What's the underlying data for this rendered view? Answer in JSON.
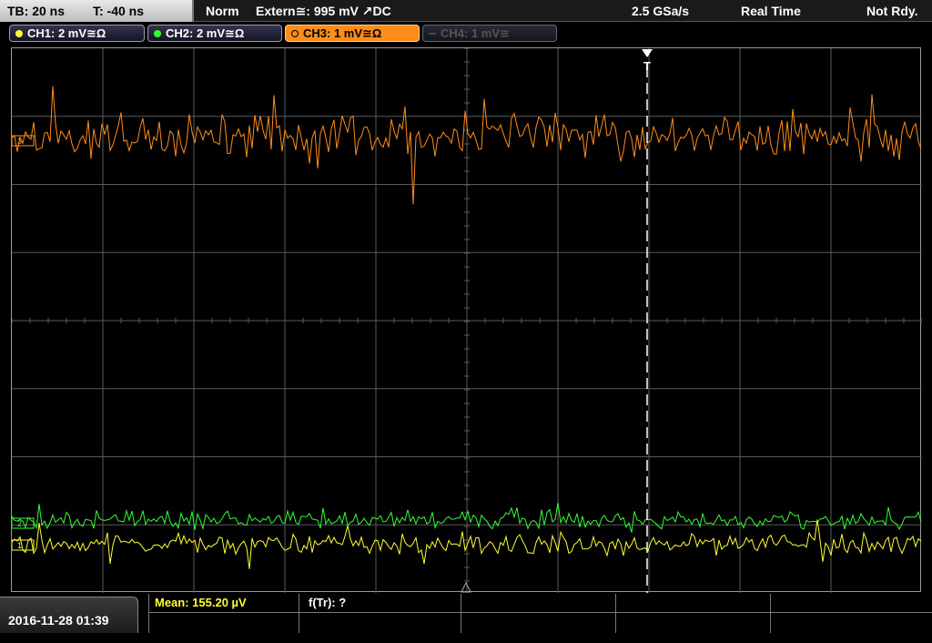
{
  "topbar": {
    "timebase": "TB: 20 ns",
    "trigger_pos": "T: -40 ns",
    "acq_mode": "Norm",
    "trigger_source": "Extern≅: 995 mV ↗DC",
    "sample_rate": "2.5 GSa/s",
    "acq_type": "Real Time",
    "status": "Not Rdy."
  },
  "channels": [
    {
      "label": "CH1: 2 mV≅Ω",
      "color": "#ffff33"
    },
    {
      "label": "CH2: 2 mV≅Ω",
      "color": "#33ff33"
    },
    {
      "label": "CH3: 1 mV≅Ω",
      "color": "#ff8c1a"
    },
    {
      "label": "CH4: 1 mV≅",
      "color": "#555555"
    }
  ],
  "trigger_marker": "T",
  "markers": {
    "ch1": "1",
    "ch2": "2",
    "ch3": "3"
  },
  "bottombar": {
    "datetime": "2016-11-28 01:39",
    "measurement_1": "Mean: 155.20 µV",
    "measurement_2": "f(Tr): ?"
  },
  "colors": {
    "ch1": "#ffff33",
    "ch2": "#33ff33",
    "ch3": "#ff8c1a",
    "grid": "#5a5a5a",
    "measurement": "#ffff33"
  },
  "icons": {
    "trigger": "trigger-arrow-icon",
    "channel_dot": "channel-dot-icon"
  }
}
